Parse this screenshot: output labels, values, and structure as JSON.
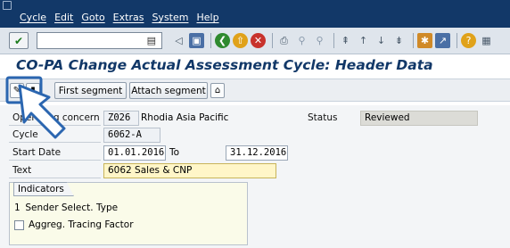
{
  "menubar": {
    "items": [
      "Cycle",
      "Edit",
      "Goto",
      "Extras",
      "System",
      "Help"
    ]
  },
  "toolbar": {
    "enter_icon": "check-icon",
    "command_field_value": "",
    "icons": [
      "save-icon",
      "back-icon",
      "exit-icon",
      "cancel-icon",
      "print-icon",
      "find-icon",
      "find-next-icon",
      "first-page-icon",
      "previous-page-icon",
      "next-page-icon",
      "last-page-icon",
      "create-session-icon",
      "shortcut-icon",
      "help-icon",
      "customize-layout-icon"
    ]
  },
  "title": "CO-PA Change Actual Assessment Cycle: Header Data",
  "app_toolbar": {
    "first_segment": "First segment",
    "attach_segment": "Attach segment"
  },
  "form": {
    "operating_concern_label": "Operating concern",
    "operating_concern_code": "Z026",
    "operating_concern_name": "Rhodia Asia Pacific",
    "status_label": "Status",
    "status_value": "Reviewed",
    "cycle_label": "Cycle",
    "cycle_value": "6062-A",
    "start_date_label": "Start Date",
    "start_date_value": "01.01.2016",
    "to_label": "To",
    "end_date_value": "31.12.2016",
    "text_label": "Text",
    "text_value": "6062 Sales & CNP"
  },
  "indicators": {
    "title": "Indicators",
    "sender_select_type_value": "1",
    "sender_select_type_label": "Sender Select. Type",
    "aggreg_tracing_factor_label": "Aggreg. Tracing Factor",
    "aggreg_tracing_factor_checked": false
  },
  "colors": {
    "menubar_bg": "#123868",
    "title_color": "#123868",
    "arrow_color": "#2b66b0"
  }
}
